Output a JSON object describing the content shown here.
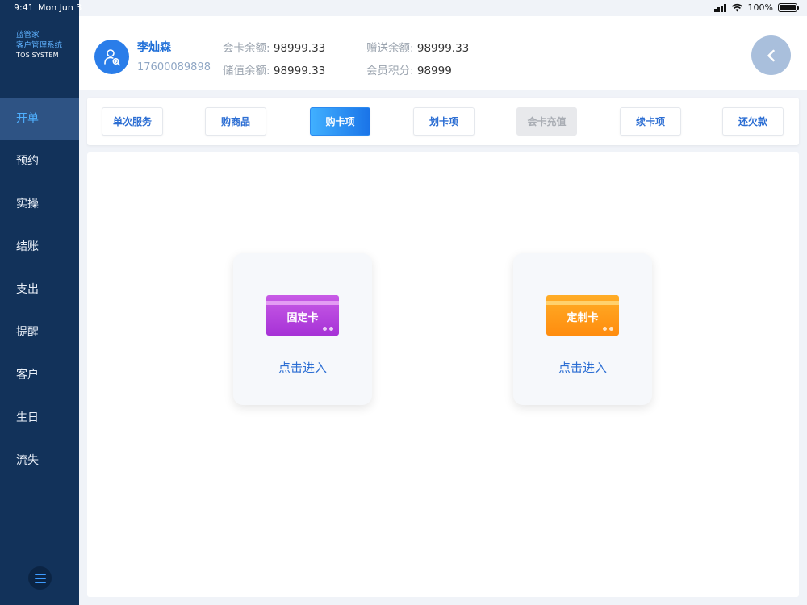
{
  "status_bar": {
    "time": "9:41",
    "date": "Mon Jun 3",
    "battery": "100%"
  },
  "brand": {
    "line1": "蓝管家",
    "line2": "客户管理系统",
    "line3": "TOS SYSTEM"
  },
  "sidebar": {
    "items": [
      {
        "label": "开单",
        "active": true
      },
      {
        "label": "预约"
      },
      {
        "label": "实操"
      },
      {
        "label": "结账"
      },
      {
        "label": "支出"
      },
      {
        "label": "提醒"
      },
      {
        "label": "客户"
      },
      {
        "label": "生日"
      },
      {
        "label": "流失"
      }
    ]
  },
  "customer": {
    "name": "李灿森",
    "phone": "17600089898",
    "card_balance_label": "会卡余额:",
    "card_balance": "98999.33",
    "gift_balance_label": "赠送余额:",
    "gift_balance": "98999.33",
    "stored_balance_label": "储值余额:",
    "stored_balance": "98999.33",
    "points_label": "会员积分:",
    "points": "98999"
  },
  "tabs": [
    {
      "label": "单次服务"
    },
    {
      "label": "购商品"
    },
    {
      "label": "购卡项",
      "active": true
    },
    {
      "label": "划卡项"
    },
    {
      "label": "会卡充值",
      "disabled": true
    },
    {
      "label": "续卡项"
    },
    {
      "label": "还欠款"
    }
  ],
  "cards": [
    {
      "name": "固定卡",
      "action": "点击进入",
      "color": "#b53fdd"
    },
    {
      "name": "定制卡",
      "action": "点击进入",
      "color": "#ff9a18"
    }
  ],
  "icons": {
    "avatar": "user-search-icon",
    "back": "chevron-left-icon",
    "menu": "hamburger-icon"
  },
  "colors": {
    "sidebar": "#12325a",
    "accent": "#2c6ed3",
    "active_nav": "#2e5384"
  }
}
